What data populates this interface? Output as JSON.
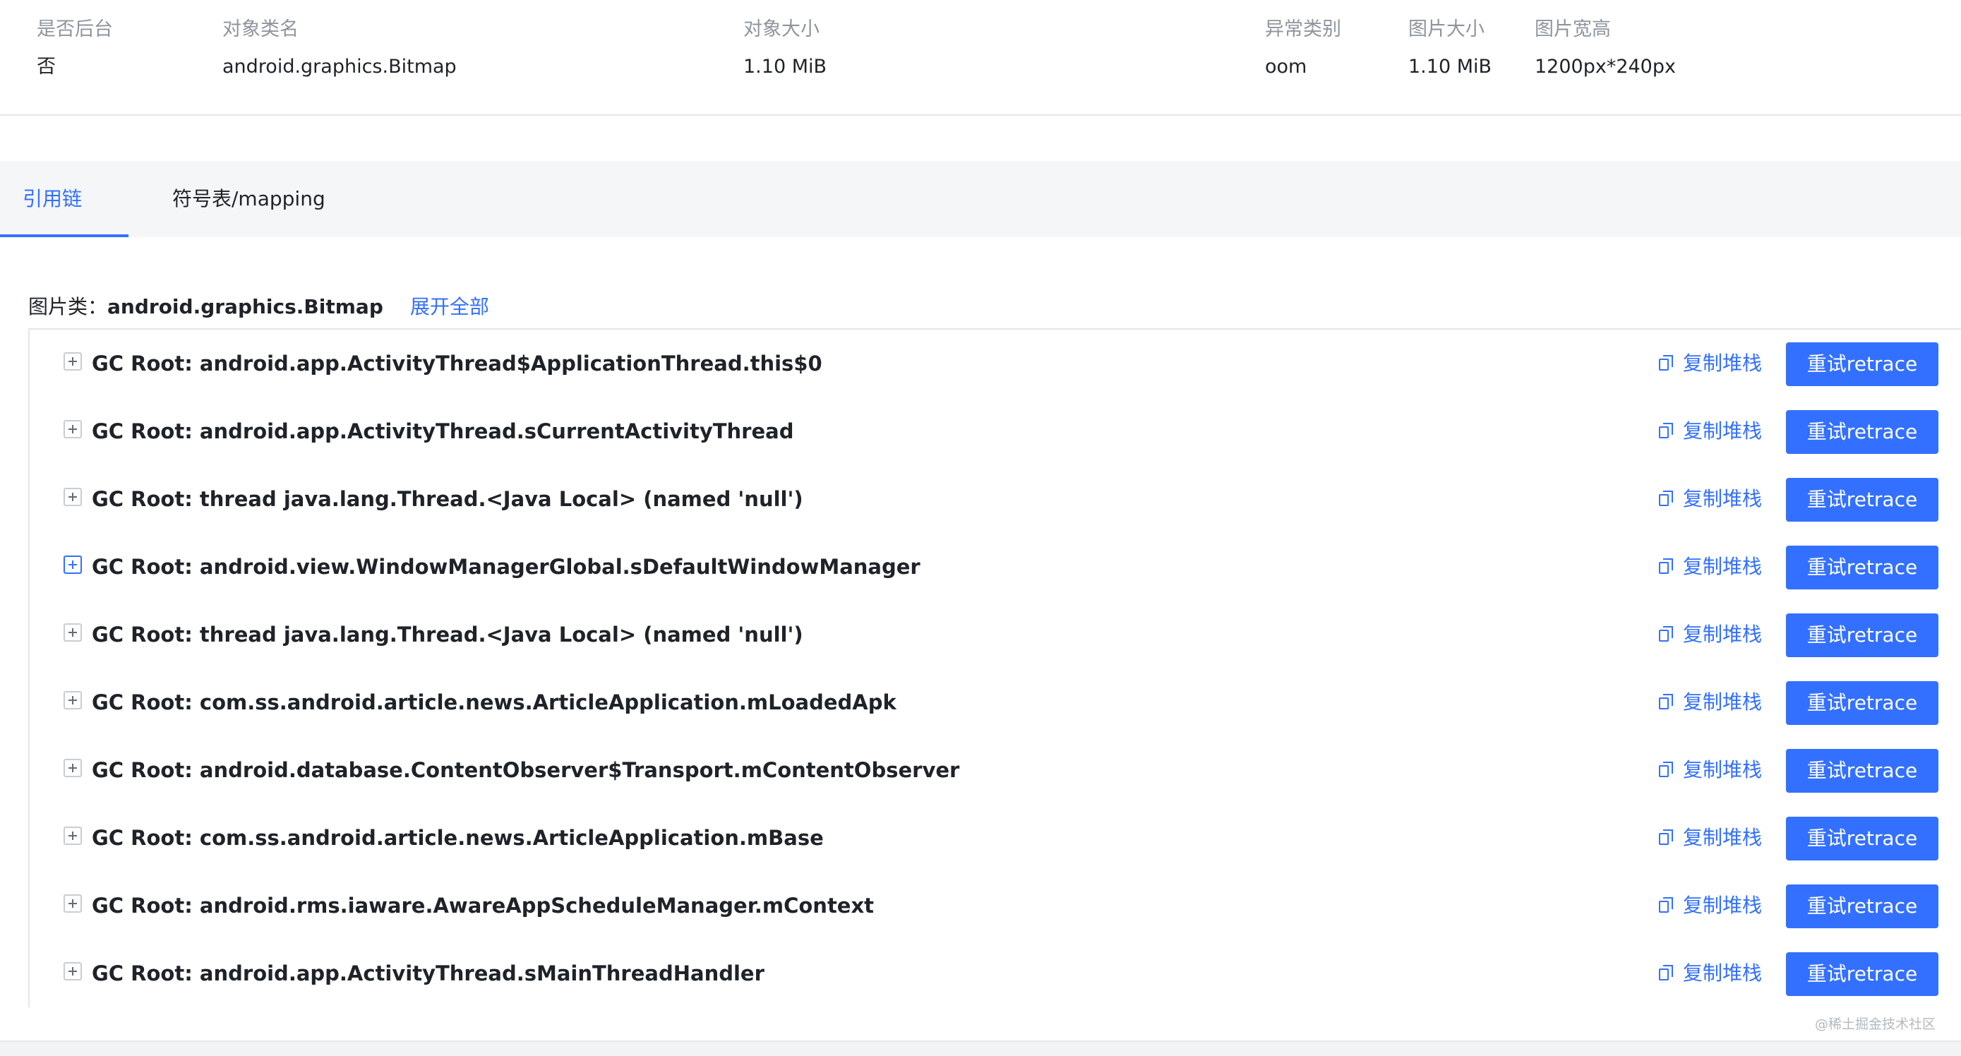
{
  "info": {
    "headers": [
      "是否后台",
      "对象类名",
      "对象大小",
      "异常类别",
      "图片大小",
      "图片宽高"
    ],
    "values": [
      "否",
      "android.graphics.Bitmap",
      "1.10 MiB",
      "oom",
      "1.10 MiB",
      "1200px*240px"
    ]
  },
  "tabs": [
    {
      "label": "引用链",
      "active": true
    },
    {
      "label": "符号表/mapping",
      "active": false
    }
  ],
  "class_header": {
    "label": "图片类：",
    "value": "android.graphics.Bitmap",
    "expand_all": "展开全部"
  },
  "actions": {
    "copy_label": "复制堆栈",
    "retrace_label": "重试retrace"
  },
  "rows": [
    {
      "title": "GC Root: android.app.ActivityThread$ApplicationThread.this$0"
    },
    {
      "title": "GC Root: android.app.ActivityThread.sCurrentActivityThread"
    },
    {
      "title": "GC Root: thread java.lang.Thread.<Java Local> (named 'null')"
    },
    {
      "title": "GC Root: android.view.WindowManagerGlobal.sDefaultWindowManager"
    },
    {
      "title": "GC Root: thread java.lang.Thread.<Java Local> (named 'null')"
    },
    {
      "title": "GC Root: com.ss.android.article.news.ArticleApplication.mLoadedApk"
    },
    {
      "title": "GC Root: android.database.ContentObserver$Transport.mContentObserver"
    },
    {
      "title": "GC Root: com.ss.android.article.news.ArticleApplication.mBase"
    },
    {
      "title": "GC Root: android.rms.iaware.AwareAppScheduleManager.mContext"
    },
    {
      "title": "GC Root: android.app.ActivityThread.sMainThreadHandler"
    }
  ],
  "credit": "@稀土掘金技术社区",
  "colors": {
    "accent": "#3370ff",
    "text": "#1f2329",
    "muted": "#8f959e",
    "tab_bg": "#f5f6f7"
  },
  "icons": {
    "expand": "plus-square-icon",
    "copy": "copy-icon"
  }
}
